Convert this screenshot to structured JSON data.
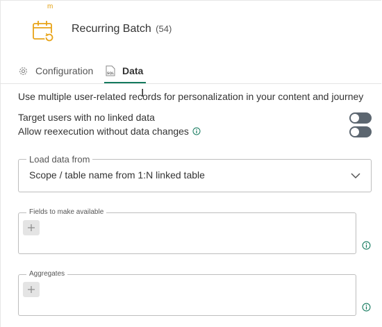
{
  "header": {
    "marker": "m",
    "title": "Recurring Batch",
    "count": "(54)",
    "icon": "calendar-recurring-icon",
    "icon_color": "#e8a317"
  },
  "tabs": [
    {
      "label": "Configuration",
      "icon": "gear-icon",
      "active": false
    },
    {
      "label": "Data",
      "icon": "sql-file-icon",
      "active": true
    }
  ],
  "accent_color": "#147a5e",
  "description": "Use multiple user-related records for personalization in your content and journey",
  "options": [
    {
      "label": "Target users with no linked data",
      "enabled": false
    },
    {
      "label": "Allow reexecution without data changes",
      "enabled": false,
      "has_info": true
    }
  ],
  "load_data": {
    "label": "Load data from",
    "value": "Scope / table name from 1:N linked table"
  },
  "fields": {
    "label": "Fields to make available"
  },
  "aggregates": {
    "label": "Aggregates"
  }
}
